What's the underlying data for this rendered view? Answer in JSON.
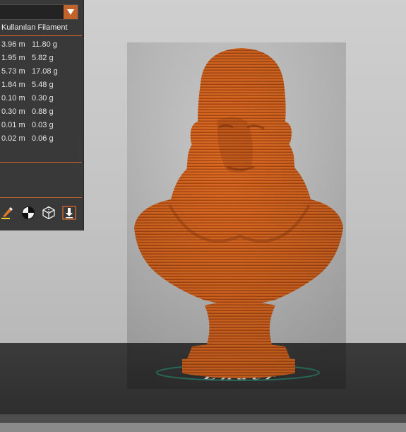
{
  "panel": {
    "column_header": "Kullanılan Filament",
    "rows": [
      {
        "length": "3.96 m",
        "weight": "11.80 g"
      },
      {
        "length": "1.95 m",
        "weight": "5.82 g"
      },
      {
        "length": "5.73 m",
        "weight": "17.08 g"
      },
      {
        "length": "1.84 m",
        "weight": "5.48 g"
      },
      {
        "length": "0.10 m",
        "weight": "0.30 g"
      },
      {
        "length": "0.30 m",
        "weight": "0.88 g"
      },
      {
        "length": "0.01 m",
        "weight": "0.03 g"
      },
      {
        "length": "0.02 m",
        "weight": "0.06 g"
      }
    ],
    "toolbar_icons": [
      "color-paint-icon",
      "center-view-icon",
      "cube-view-icon",
      "download-icon"
    ]
  },
  "build_plate": {
    "logo_text": "Ender"
  },
  "colors": {
    "accent": "#c2632b",
    "filament": "#d9651f",
    "panel_bg": "#393939",
    "plate": "#333333"
  }
}
